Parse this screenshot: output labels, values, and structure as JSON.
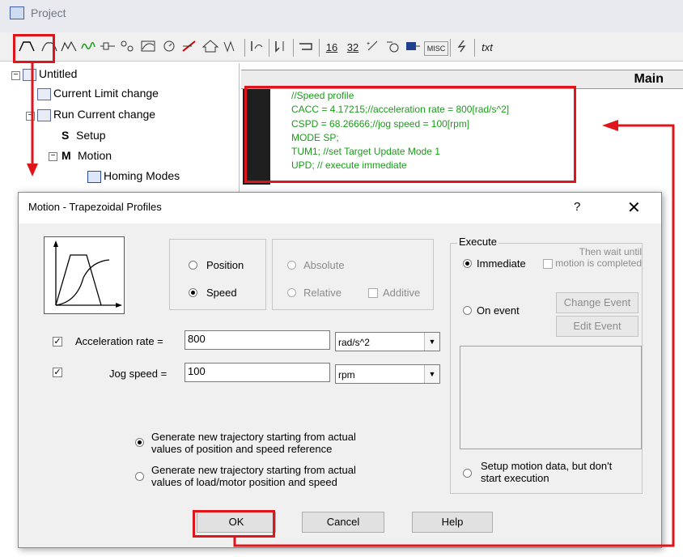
{
  "window": {
    "title": "Project"
  },
  "toolbar": {
    "icons": [
      "trapezoid-profile-icon",
      "s-curve-profile-icon",
      "pt-profile-icon",
      "pvt-profile-icon",
      "contouring-icon",
      "gear-icon",
      "cam-icon",
      "clock-icon",
      "electronic-gearing-icon",
      "homing-icon",
      "test-icon",
      "jump-icon",
      "call-icon",
      "assignment-icon",
      "16bit-icon",
      "32bit-icon",
      "arithmetic-icon",
      "events-icon",
      "io-icon",
      "misc-icon",
      "interrupt-icon",
      "text-icon"
    ],
    "text_labels": {
      "b16": "16",
      "b32": "32",
      "misc": "MISC",
      "txt": "txt"
    }
  },
  "tree": {
    "root": "Untitled",
    "items": [
      {
        "label": "Current Limit change"
      },
      {
        "label": "Run Current change"
      },
      {
        "prefix": "S",
        "label": "Setup"
      },
      {
        "prefix": "M",
        "label": "Motion"
      },
      {
        "label": "Homing Modes"
      }
    ]
  },
  "editor": {
    "header": "Main",
    "lines": [
      "//Speed profile",
      "CACC = 4.17215;//acceleration rate = 800[rad/s^2]",
      "CSPD = 68.26666;//jog speed = 100[rpm]",
      "MODE SP;",
      "TUM1; //set Target Update Mode 1",
      "UPD; // execute immediate"
    ]
  },
  "dialog": {
    "title": "Motion - Trapezoidal Profiles",
    "help_glyph": "?",
    "close_glyph": "✕",
    "mode": {
      "position": "Position",
      "speed": "Speed"
    },
    "reference": {
      "absolute": "Absolute",
      "relative": "Relative",
      "additive": "Additive"
    },
    "acceleration": {
      "label": "Acceleration rate =",
      "value": "800",
      "unit": "rad/s^2"
    },
    "jog": {
      "label": "Jog speed =",
      "value": "100",
      "unit": "rpm"
    },
    "execute": {
      "group_label": "Execute",
      "immediate": "Immediate",
      "then_wait": "Then wait until motion is completed",
      "on_event": "On event",
      "change_event": "Change Event",
      "edit_event": "Edit Event",
      "setup_only": "Setup motion data, but don't start execution"
    },
    "trajectory": {
      "option1": "Generate new trajectory starting from actual values of position and speed reference",
      "option2": "Generate new trajectory starting from actual values of load/motor position and speed"
    },
    "buttons": {
      "ok": "OK",
      "cancel": "Cancel",
      "help": "Help"
    }
  },
  "colors": {
    "annotation_red": "#e0151b",
    "code_green": "#1a9c1a"
  }
}
